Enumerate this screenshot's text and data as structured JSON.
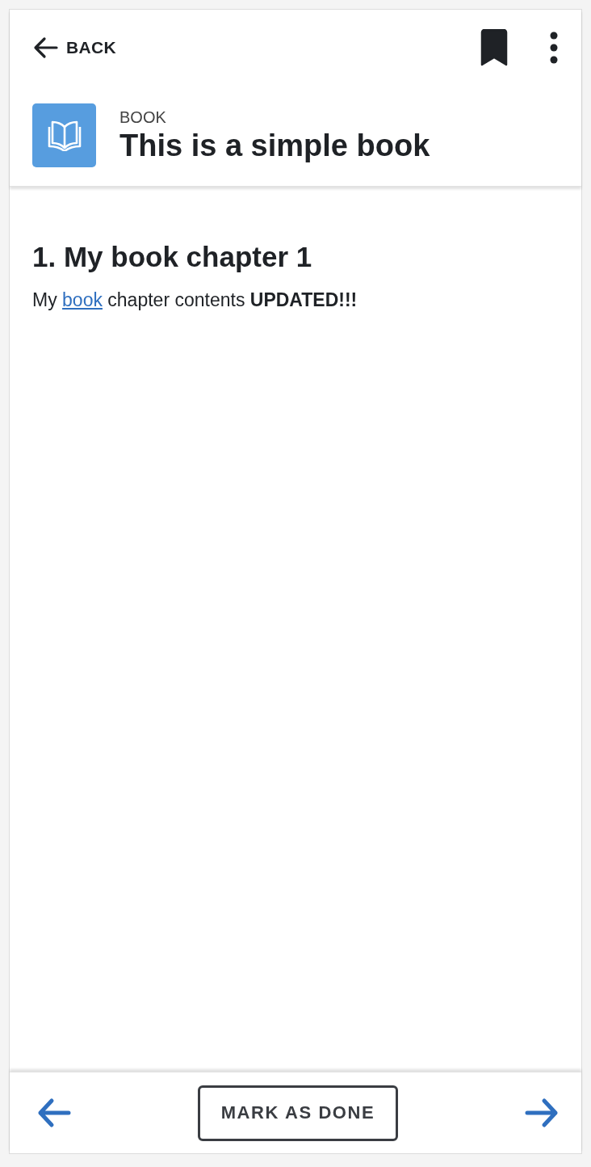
{
  "top_bar": {
    "back_label": "BACK",
    "bookmarked": true
  },
  "header": {
    "type_label": "BOOK",
    "title": "This is a simple book"
  },
  "chapter": {
    "heading": "1. My book chapter 1",
    "paragraph": {
      "before": "My",
      "link": "book",
      "after": "chapter contents **UPDATED!!!**"
    }
  },
  "footer": {
    "button_label": "MARK AS DONE"
  }
}
